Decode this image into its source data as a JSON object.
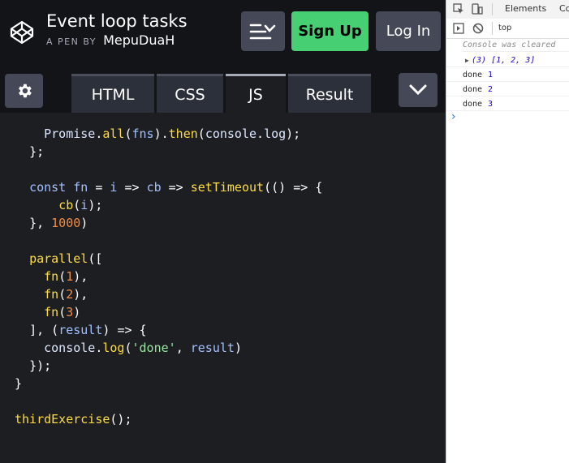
{
  "header": {
    "title": "Event loop tasks",
    "subtitle_prefix": "A PEN BY",
    "author": "MepuDuaH",
    "signup_label": "Sign Up",
    "login_label": "Log In"
  },
  "tabs": [
    {
      "label": "HTML",
      "active": false
    },
    {
      "label": "CSS",
      "active": false
    },
    {
      "label": "JS",
      "active": true
    },
    {
      "label": "Result",
      "active": false
    }
  ],
  "code_lines": [
    "    Promise.all(fns).then(console.log);",
    "  };",
    "",
    "  const fn = i => cb => setTimeout(() => {",
    "      cb(i);",
    "  }, 1000)",
    "",
    "  parallel([",
    "    fn(1),",
    "    fn(2),",
    "    fn(3)",
    "  ], (result) => {",
    "    console.log('done', result)",
    "  });",
    "}",
    "",
    "thirdExercise();"
  ],
  "devtools": {
    "tabs": [
      "Elements",
      "Co"
    ],
    "context": "top",
    "console_cleared": "Console was cleared",
    "array_log": "(3) [1, 2, 3]",
    "logs": [
      {
        "text": "done",
        "value": "1"
      },
      {
        "text": "done",
        "value": "2"
      },
      {
        "text": "done",
        "value": "3"
      }
    ],
    "prompt": "›"
  }
}
